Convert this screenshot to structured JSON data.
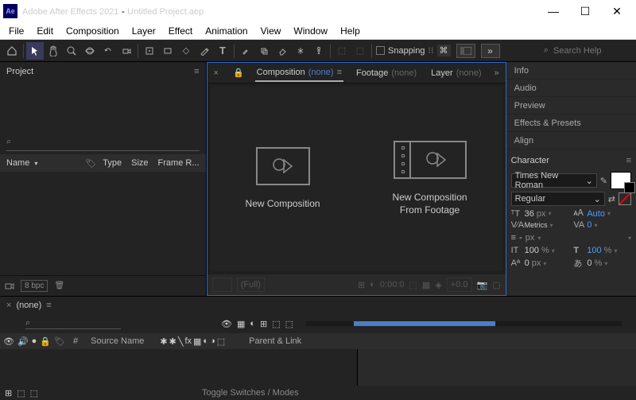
{
  "titlebar": {
    "app": "Adobe After Effects 2021",
    "project": "Untitled Project.aep"
  },
  "menu": [
    "File",
    "Edit",
    "Composition",
    "Layer",
    "Effect",
    "Animation",
    "View",
    "Window",
    "Help"
  ],
  "toolbar": {
    "snapping": "Snapping",
    "search_placeholder": "Search Help"
  },
  "project_panel": {
    "title": "Project",
    "cols": {
      "name": "Name",
      "type": "Type",
      "size": "Size",
      "frame": "Frame R..."
    },
    "footer": {
      "bpc": "8 bpc"
    }
  },
  "center": {
    "tabs": {
      "comp": "Composition",
      "none": "(none)",
      "footage": "Footage",
      "layer": "Layer"
    },
    "cards": {
      "new_comp": "New Composition",
      "from_footage": "New Composition\nFrom Footage"
    }
  },
  "right": {
    "sections": [
      "Info",
      "Audio",
      "Preview",
      "Effects & Presets",
      "Align"
    ],
    "character": {
      "title": "Character",
      "font": "Times New Roman",
      "style": "Regular",
      "size": "36",
      "size_unit": "px",
      "leading": "Auto",
      "kerning": "Metrics",
      "tracking": "0",
      "stroke_style": "-",
      "stroke_unit": "px",
      "vscale": "100",
      "vscale_unit": "%",
      "hscale": "100",
      "hscale_unit": "%",
      "baseline": "0",
      "baseline_unit": "px",
      "tsume": "0",
      "tsume_unit": "%"
    }
  },
  "timeline": {
    "tab": "(none)",
    "cols": {
      "source": "Source Name",
      "parent": "Parent & Link"
    },
    "toggle": "Toggle Switches / Modes"
  }
}
